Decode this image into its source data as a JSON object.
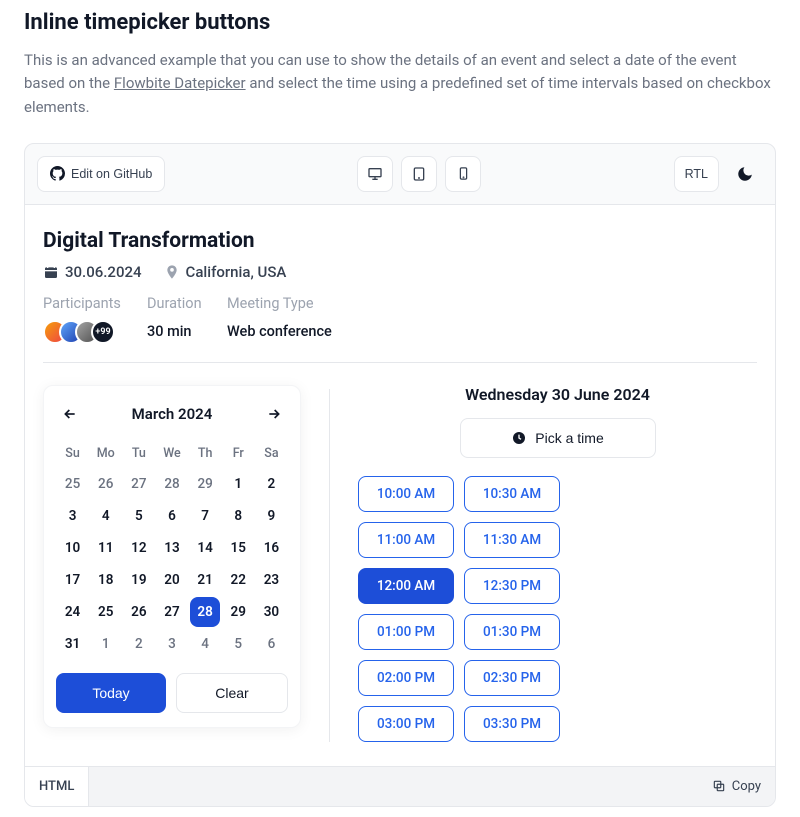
{
  "heading": "Inline timepicker buttons",
  "intro": {
    "pre": "This is an advanced example that you can use to show the details of an event and select a date of the event based on the ",
    "link": "Flowbite Datepicker",
    "post": " and select the time using a predefined set of time intervals based on checkbox elements."
  },
  "toolbar": {
    "edit_label": "Edit on GitHub",
    "rtl_label": "RTL"
  },
  "event": {
    "title": "Digital Transformation",
    "date": "30.06.2024",
    "location": "California, USA",
    "headers": {
      "participants": "Participants",
      "duration": "Duration",
      "meeting_type": "Meeting Type"
    },
    "values": {
      "duration": "30 min",
      "meeting_type": "Web conference",
      "more_badge": "+99"
    }
  },
  "calendar": {
    "month_label": "March 2024",
    "dow": [
      "Su",
      "Mo",
      "Tu",
      "We",
      "Th",
      "Fr",
      "Sa"
    ],
    "days": [
      {
        "n": "25",
        "muted": true
      },
      {
        "n": "26",
        "muted": true
      },
      {
        "n": "27",
        "muted": true
      },
      {
        "n": "28",
        "muted": true
      },
      {
        "n": "29",
        "muted": true
      },
      {
        "n": "1"
      },
      {
        "n": "2"
      },
      {
        "n": "3"
      },
      {
        "n": "4"
      },
      {
        "n": "5"
      },
      {
        "n": "6"
      },
      {
        "n": "7"
      },
      {
        "n": "8"
      },
      {
        "n": "9"
      },
      {
        "n": "10"
      },
      {
        "n": "11"
      },
      {
        "n": "12"
      },
      {
        "n": "13"
      },
      {
        "n": "14"
      },
      {
        "n": "15"
      },
      {
        "n": "16"
      },
      {
        "n": "17"
      },
      {
        "n": "18"
      },
      {
        "n": "19"
      },
      {
        "n": "20"
      },
      {
        "n": "21"
      },
      {
        "n": "22"
      },
      {
        "n": "23"
      },
      {
        "n": "24"
      },
      {
        "n": "25"
      },
      {
        "n": "26"
      },
      {
        "n": "27"
      },
      {
        "n": "28",
        "sel": true
      },
      {
        "n": "29"
      },
      {
        "n": "30"
      },
      {
        "n": "31"
      },
      {
        "n": "1",
        "muted": true
      },
      {
        "n": "2",
        "muted": true
      },
      {
        "n": "3",
        "muted": true
      },
      {
        "n": "4",
        "muted": true
      },
      {
        "n": "5",
        "muted": true
      },
      {
        "n": "6",
        "muted": true
      }
    ],
    "today_label": "Today",
    "clear_label": "Clear"
  },
  "time": {
    "title": "Wednesday 30 June 2024",
    "pick_label": "Pick a time",
    "slots": [
      {
        "t": "10:00 AM"
      },
      {
        "t": "10:30 AM"
      },
      {
        "t": "11:00 AM"
      },
      {
        "t": "11:30 AM"
      },
      {
        "t": "12:00 AM",
        "active": true
      },
      {
        "t": "12:30 PM"
      },
      {
        "t": "01:00 PM"
      },
      {
        "t": "01:30 PM"
      },
      {
        "t": "02:00 PM"
      },
      {
        "t": "02:30 PM"
      },
      {
        "t": "03:00 PM"
      },
      {
        "t": "03:30 PM"
      }
    ]
  },
  "codebar": {
    "tab": "HTML",
    "copy": "Copy"
  }
}
